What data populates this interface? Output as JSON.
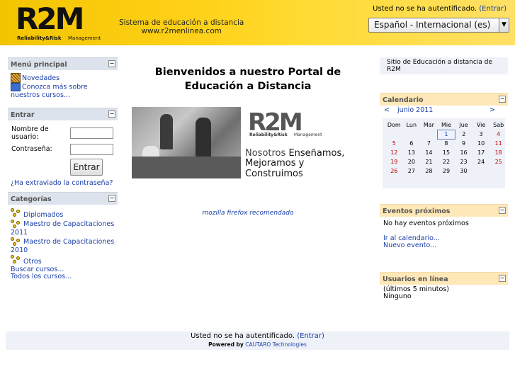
{
  "header": {
    "logo_text": "R2M",
    "logo_sub_bold": "Reliability&Risk",
    "logo_sub": "Management",
    "tagline_1": "Sistema de educación a distancia",
    "tagline_2": "www.r2menlinea.com",
    "auth_text": "Usted no se ha autentificado.",
    "auth_link": "(Entrar)",
    "language_selected": "Español - Internacional (es)"
  },
  "menu": {
    "title": "Menú principal",
    "items": [
      "Novedades",
      "Conozca más sobre nuestros cursos..."
    ]
  },
  "login": {
    "title": "Entrar",
    "username_label": "Nombre de usuario:",
    "password_label": "Contraseña:",
    "button": "Entrar",
    "forgot": "¿Ha extraviado la contraseña?"
  },
  "categories": {
    "title": "Categorías",
    "items": [
      "Diplomados",
      "Maestro de Capacitaciones 2011",
      "Maestro de Capacitaciones 2010",
      "Otros"
    ],
    "search": "Buscar cursos...",
    "all": "Todos los cursos..."
  },
  "main": {
    "welcome": "Bienvenidos a nuestro Portal de Educación a Distancia",
    "banner_logo": "R2M",
    "banner_sub_bold": "Reliability&Risk",
    "banner_sub": "Management",
    "banner_line1_a": "Nosotros",
    "banner_line1_b": "Enseñamos,",
    "banner_line2": "Mejoramos y Construimos",
    "firefox": "mozilla firefox recomendado"
  },
  "site_info": "Sitio de Educación a distancia de R2M",
  "calendar": {
    "title": "Calendario",
    "prev": "<",
    "month": "junio 2011",
    "next": ">",
    "days": [
      "Dom",
      "Lun",
      "Mar",
      "Mie",
      "Jue",
      "Vie",
      "Sab"
    ],
    "weeks": [
      [
        "",
        "",
        "",
        "1",
        "2",
        "3",
        "4"
      ],
      [
        "5",
        "6",
        "7",
        "8",
        "9",
        "10",
        "11"
      ],
      [
        "12",
        "13",
        "14",
        "15",
        "16",
        "17",
        "18"
      ],
      [
        "19",
        "20",
        "21",
        "22",
        "23",
        "24",
        "25"
      ],
      [
        "26",
        "27",
        "28",
        "29",
        "30",
        "",
        ""
      ]
    ],
    "today": "1"
  },
  "events": {
    "title": "Eventos próximos",
    "empty": "No hay eventos próximos",
    "goto": "Ir al calendario...",
    "new": "Nuevo evento..."
  },
  "online": {
    "title": "Usuarios en línea",
    "subtitle": "(últimos 5 minutos)",
    "value": "Ninguno"
  },
  "footer": {
    "auth_text": "Usted no se ha autentificado.",
    "auth_link": "(Entrar)",
    "powered": "Powered by",
    "powered_link": "CAUTARO Technologies"
  }
}
